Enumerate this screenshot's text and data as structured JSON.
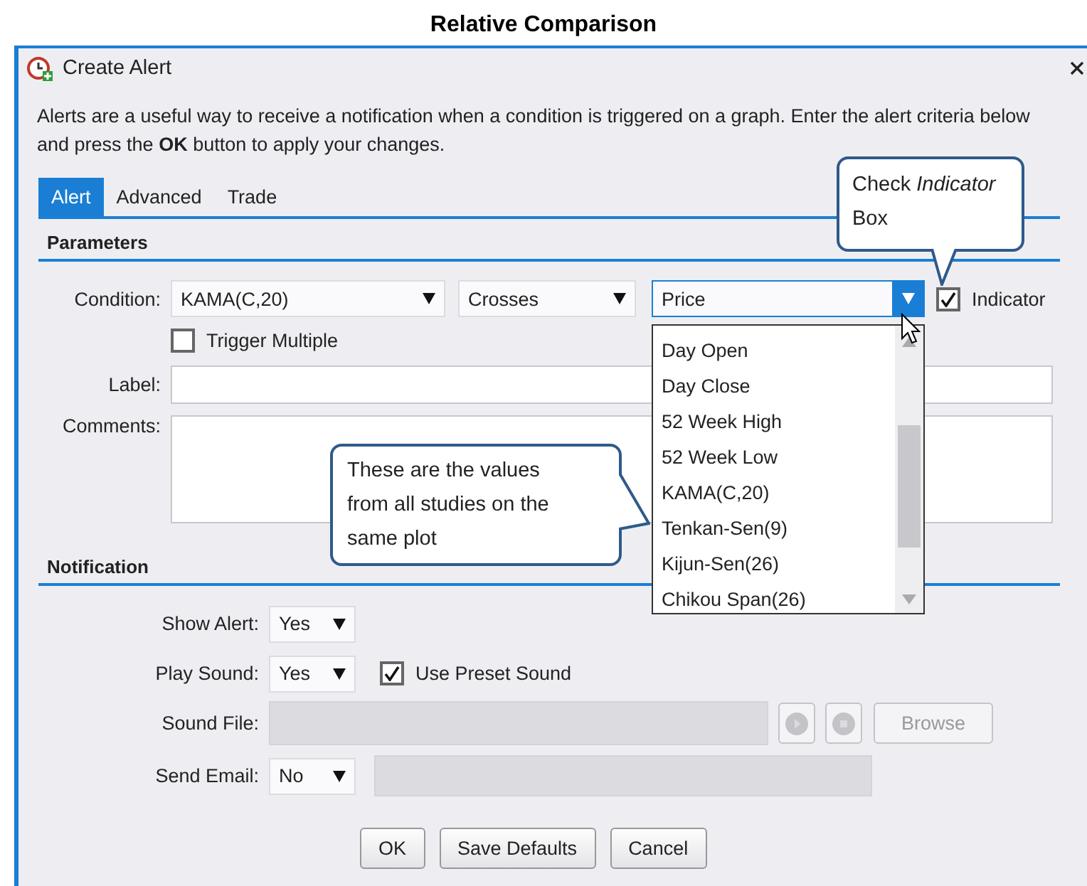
{
  "page_title": "Relative Comparison",
  "window": {
    "title": "Create Alert"
  },
  "description": "Alerts are a useful way to receive a notification when a condition is triggered on a graph. Enter the alert criteria below and press the **OK** button to apply your changes.",
  "tabs": [
    {
      "label": "Alert",
      "selected": true
    },
    {
      "label": "Advanced",
      "selected": false
    },
    {
      "label": "Trade",
      "selected": false
    }
  ],
  "parameters": {
    "heading": "Parameters",
    "condition": {
      "label": "Condition:",
      "operand": "KAMA(C,20)",
      "operator": "Crosses",
      "target": "Price",
      "indicator": {
        "label": "Indicator",
        "checked": true
      }
    },
    "trigger_multiple": {
      "label": "Trigger Multiple",
      "checked": false
    },
    "label_field": {
      "label": "Label:"
    },
    "comments_field": {
      "label": "Comments:"
    }
  },
  "dropdown_list": {
    "items": [
      "Day Open",
      "Day Close",
      "52 Week High",
      "52 Week Low",
      "KAMA(C,20)",
      "Tenkan-Sen(9)",
      "Kijun-Sen(26)",
      "Chikou Span(26)"
    ]
  },
  "notification": {
    "heading": "Notification",
    "show_alert": {
      "label": "Show Alert:",
      "value": "Yes"
    },
    "play_sound": {
      "label": "Play Sound:",
      "value": "Yes",
      "use_preset": {
        "label": "Use Preset Sound",
        "checked": true
      }
    },
    "sound_file": {
      "label": "Sound File:",
      "disabled": true,
      "browse": "Browse"
    },
    "send_email": {
      "label": "Send Email:",
      "value": "No"
    }
  },
  "buttons": [
    "OK",
    "Save Defaults",
    "Cancel"
  ],
  "callouts": [
    {
      "text": "Check *Indicator* Box"
    },
    {
      "text": "These are the values from all studies on the same plot"
    }
  ]
}
